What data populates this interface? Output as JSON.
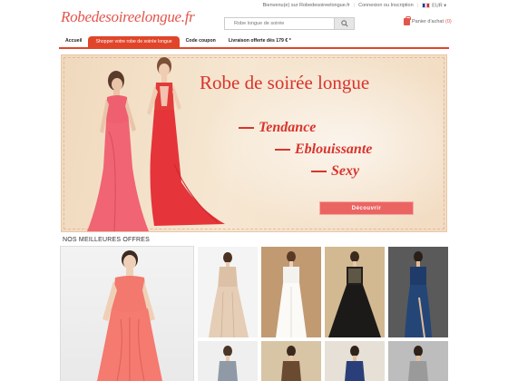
{
  "header": {
    "logo_prefix": "Robedesoireelongue",
    "logo_suffix": ".fr",
    "links": [
      "Bienvenu(e) sur Robedesoireelongue.fr",
      "Connexion ou Inscription"
    ],
    "currency": "EUR",
    "search_placeholder": "Robe longue de soirée",
    "cart_label": "Panier d'achat",
    "cart_count": "(0)"
  },
  "nav": {
    "items": [
      {
        "label": "Accueil",
        "active": false
      },
      {
        "label": "Shopper votre robe de soirée longue",
        "active": true
      },
      {
        "label": "Code coupon",
        "active": false
      },
      {
        "label": "Livraison offerte dès 179 € *",
        "active": false
      }
    ]
  },
  "banner": {
    "title": "Robe de soirée longue",
    "lines": [
      "Tendance",
      "Eblouissante",
      "Sexy"
    ],
    "button": "Découvrir"
  },
  "offers": {
    "title": "NOS MEILLEURES OFFRES",
    "tiles": [
      {
        "name": "large-coral-dress"
      },
      {
        "name": "champagne-lace-dress"
      },
      {
        "name": "white-chiffon-dress"
      },
      {
        "name": "black-sequin-dress"
      },
      {
        "name": "navy-slit-dress"
      }
    ]
  },
  "colors": {
    "brand": "#e2554d",
    "nav_accent": "#e0452a",
    "banner_button": "#ea6562"
  }
}
